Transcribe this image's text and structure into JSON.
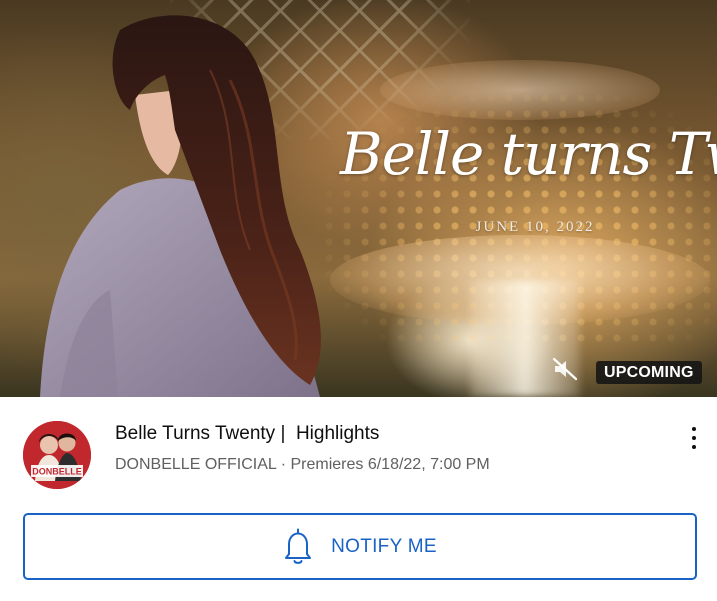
{
  "thumbnail": {
    "title_text": "Belle turns Twenty",
    "date_text": "JUNE 10, 2022",
    "badge": "UPCOMING",
    "mute_icon": "muted-speaker-icon"
  },
  "video": {
    "title": "Belle Turns Twenty |  Highlights",
    "channel": "DONBELLE OFFICIAL",
    "separator": "·",
    "premiere": "Premieres 6/18/22, 7:00 PM",
    "avatar_text": "DONBELLE",
    "menu_icon": "more-vert-icon"
  },
  "notify_button": {
    "label": "NOTIFY ME",
    "icon": "bell-icon"
  },
  "colors": {
    "accent": "#1a63c6",
    "title_text": "#0f0f0f",
    "secondary_text": "#606060",
    "badge_bg": "#141414"
  }
}
